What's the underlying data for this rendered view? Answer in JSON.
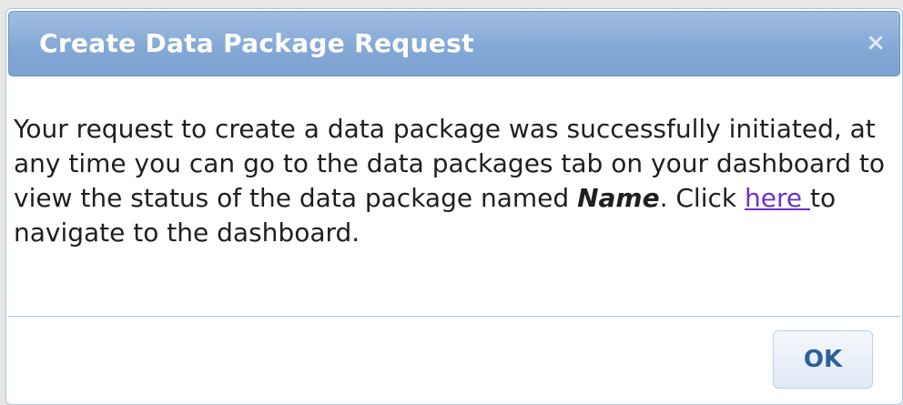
{
  "dialog": {
    "title": "Create Data Package Request",
    "close_symbol": "×",
    "message": {
      "text_before": "Your request to create a data package was successfully initiated, at any time you can go to the data packages tab on your dashboard to view the status of the data package named ",
      "name": "Name",
      "text_middle": ". Click ",
      "link": "here ",
      "text_after": "to navigate to the dashboard."
    },
    "ok_label": "OK"
  }
}
